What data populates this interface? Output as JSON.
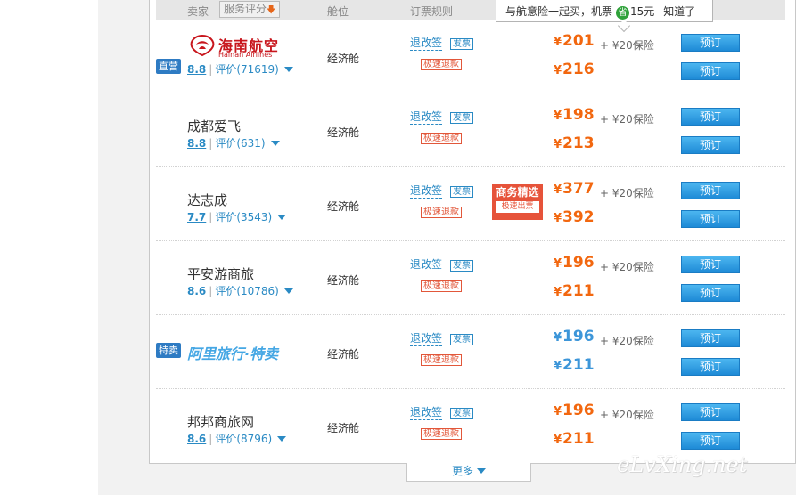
{
  "header": {
    "seller": "卖家",
    "service_sort": "服务评分",
    "cabin": "舱位",
    "rules": "订票规则"
  },
  "tooltip": {
    "text": "与航意险一起买，机票",
    "save_icon": "省",
    "amount": "15元",
    "ok": "知道了"
  },
  "rows": [
    {
      "badge": "直营",
      "name_cn": "海南航空",
      "name_en": "Hainan Airlines",
      "score": "8.8",
      "review": "评价(71619)",
      "cabin": "经济舱",
      "refund": "退改签",
      "invoice": "发票",
      "fast": "极速退款",
      "price1": "201",
      "insurance": "+ ¥20保险",
      "price2": "216",
      "book": "预订"
    },
    {
      "name": "成都爱飞",
      "score": "8.8",
      "review": "评价(631)",
      "cabin": "经济舱",
      "refund": "退改签",
      "invoice": "发票",
      "fast": "极速退款",
      "price1": "198",
      "insurance": "+ ¥20保险",
      "price2": "213",
      "book": "预订"
    },
    {
      "name": "达志成",
      "score": "7.7",
      "review": "评价(3543)",
      "cabin": "经济舱",
      "refund": "退改签",
      "invoice": "发票",
      "fast": "极速退款",
      "biz_title": "商务精选",
      "biz_sub": "极速出票",
      "price1": "377",
      "insurance": "+ ¥20保险",
      "price2": "392",
      "book": "预订"
    },
    {
      "name": "平安游商旅",
      "score": "8.6",
      "review": "评价(10786)",
      "cabin": "经济舱",
      "refund": "退改签",
      "invoice": "发票",
      "fast": "极速退款",
      "price1": "196",
      "insurance": "+ ¥20保险",
      "price2": "211",
      "book": "预订"
    },
    {
      "badge": "特卖",
      "name": "阿里旅行·特卖",
      "cabin": "经济舱",
      "refund": "退改签",
      "invoice": "发票",
      "fast": "极速退款",
      "price1": "196",
      "insurance": "+ ¥20保险",
      "price2": "211",
      "book": "预订"
    },
    {
      "name": "邦邦商旅网",
      "score": "8.6",
      "review": "评价(8796)",
      "cabin": "经济舱",
      "refund": "退改签",
      "invoice": "发票",
      "fast": "极速退款",
      "price1": "196",
      "insurance": "+ ¥20保险",
      "price2": "211",
      "book": "预订"
    }
  ],
  "currency": "¥",
  "more": "更多",
  "watermark": "eLvXing.net",
  "colors": {
    "accent_blue": "#2a8ac4",
    "price_orange": "#f2670f",
    "price_blue": "#3d96d9",
    "book_button": "#1e8ad6",
    "fast_refund_red": "#e2573a",
    "hainan_red": "#c8161d"
  },
  "icons": {
    "sort_down": "arrow-down-icon",
    "dropdown": "triangle-down-icon",
    "save": "save-icon",
    "hainan_logo": "hainan-airlines-logo"
  }
}
